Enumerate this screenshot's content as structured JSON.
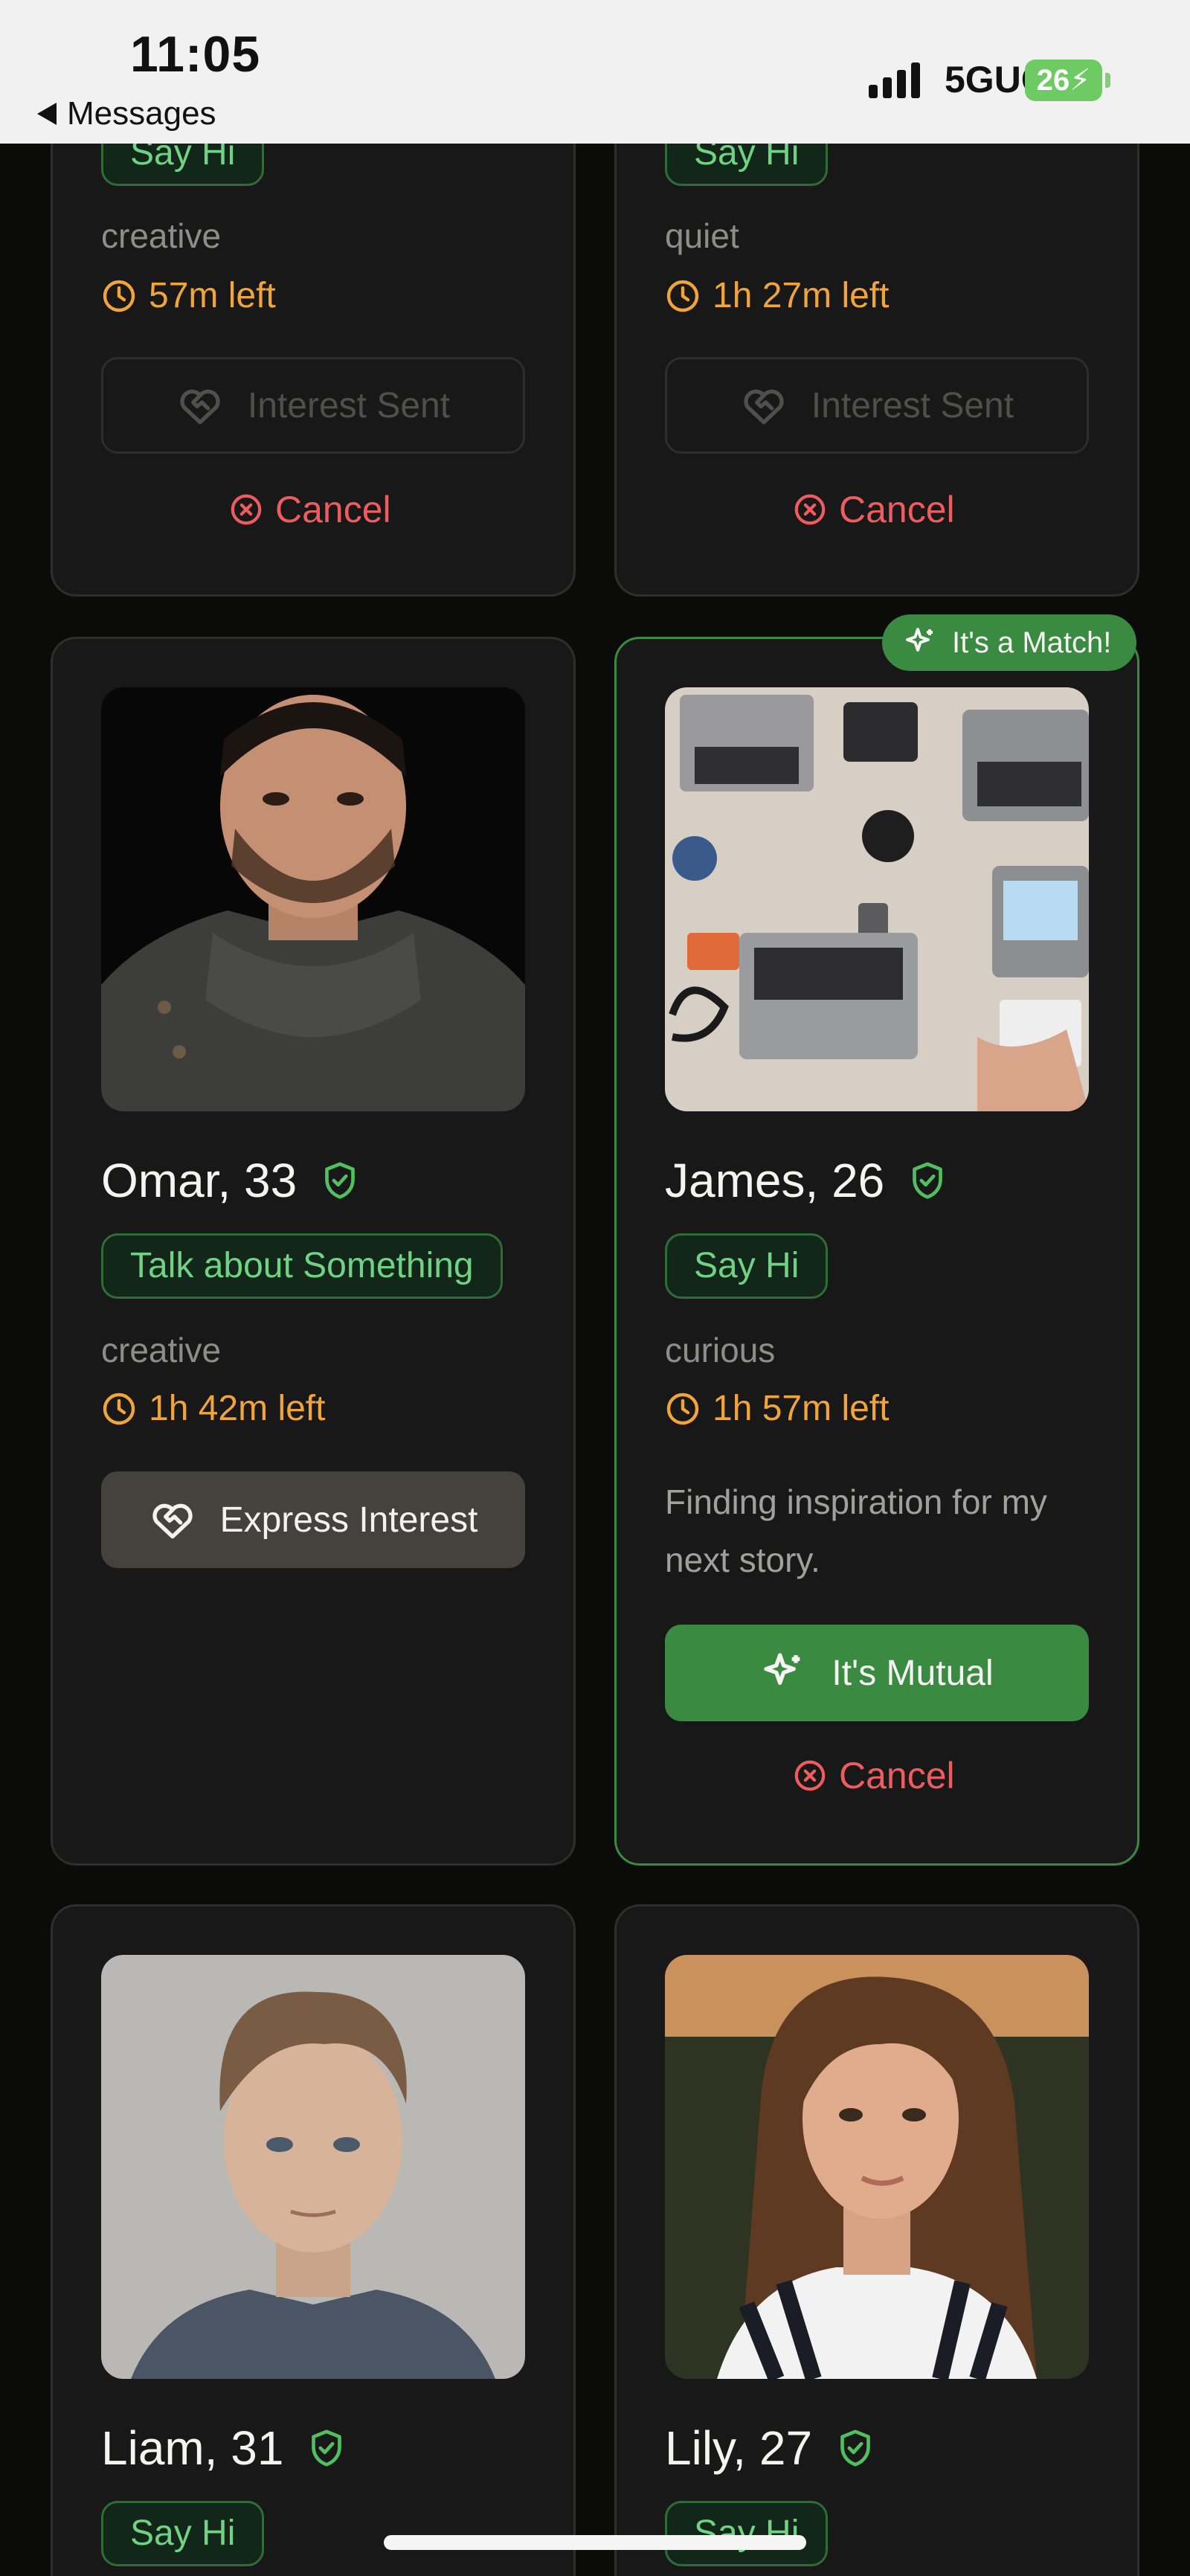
{
  "status_bar": {
    "time": "11:05",
    "back_label": "Messages",
    "network": "5GUC",
    "battery": "26"
  },
  "colors": {
    "accent_green": "#3b8a42",
    "timer_orange": "#f0a53b",
    "cancel_red": "#ee5c60",
    "card_bg": "#181818"
  },
  "cards": [
    {
      "tag": "Say Hi",
      "mood": "creative",
      "time_left": "57m left",
      "action": "Interest Sent",
      "cancel": "Cancel"
    },
    {
      "tag": "Say Hi",
      "mood": "quiet",
      "time_left": "1h 27m left",
      "action": "Interest Sent",
      "cancel": "Cancel"
    },
    {
      "name": "Omar, 33",
      "tag": "Talk about Something",
      "mood": "creative",
      "time_left": "1h 42m left",
      "action": "Express Interest"
    },
    {
      "name": "James, 26",
      "badge": "It's a Match!",
      "tag": "Say Hi",
      "mood": "curious",
      "time_left": "1h 57m left",
      "bio": "Finding inspiration for my next story.",
      "action": "It's Mutual",
      "cancel": "Cancel"
    },
    {
      "name": "Liam, 31",
      "tag": "Say Hi"
    },
    {
      "name": "Lily, 27",
      "tag": "Say Hi"
    }
  ]
}
